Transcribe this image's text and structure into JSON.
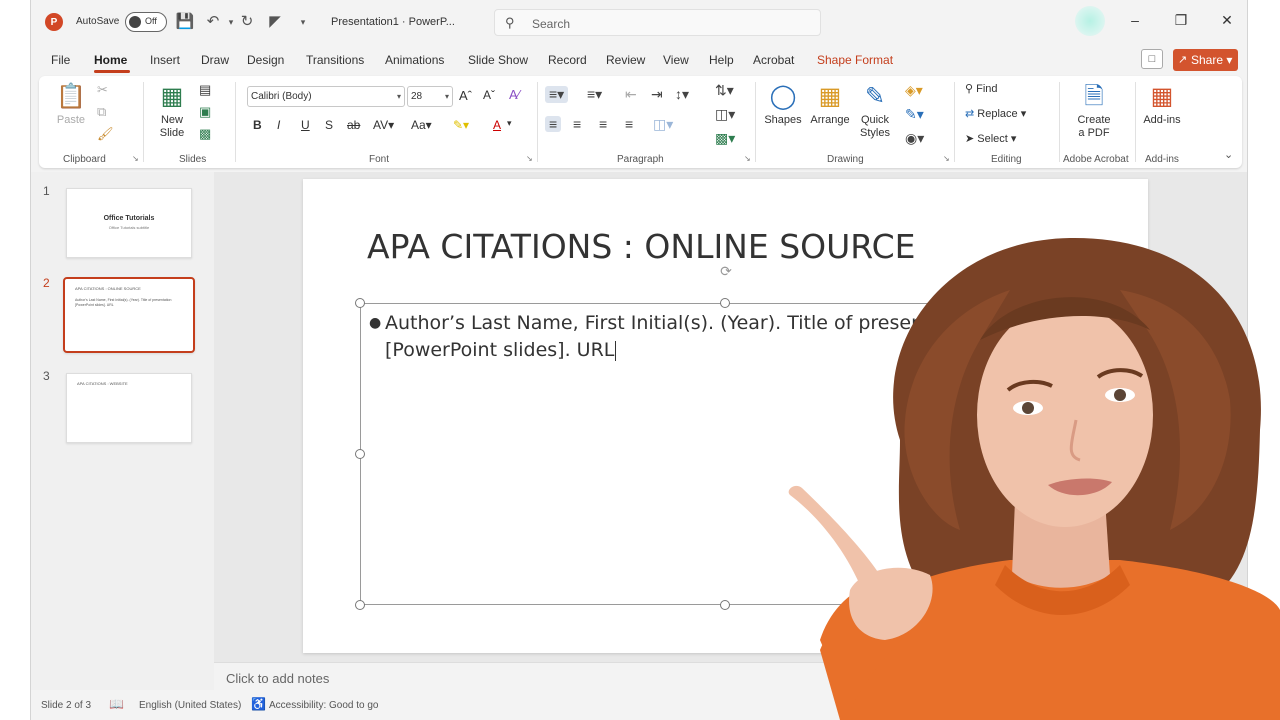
{
  "titlebar": {
    "autosave_label": "AutoSave",
    "autosave_state": "Off",
    "doc_title": "Presentation1  ·  PowerP...",
    "search_placeholder": "Search"
  },
  "tabs": [
    "File",
    "Home",
    "Insert",
    "Draw",
    "Design",
    "Transitions",
    "Animations",
    "Slide Show",
    "Record",
    "Review",
    "View",
    "Help",
    "Acrobat",
    "Shape Format"
  ],
  "share_label": "Share",
  "ribbon": {
    "clipboard": {
      "paste": "Paste",
      "label": "Clipboard"
    },
    "slides": {
      "new_slide": "New Slide",
      "label": "Slides"
    },
    "font": {
      "font_name": "Calibri (Body)",
      "font_size": "28",
      "label": "Font"
    },
    "paragraph": {
      "label": "Paragraph"
    },
    "drawing": {
      "shapes": "Shapes",
      "arrange": "Arrange",
      "quick_styles": "Quick Styles",
      "label": "Drawing"
    },
    "editing": {
      "find": "Find",
      "replace": "Replace",
      "select": "Select",
      "label": "Editing"
    },
    "acrobat": {
      "create_pdf": "Create a PDF",
      "label": "Adobe Acrobat"
    },
    "addins": {
      "addins": "Add-ins",
      "label": "Add-ins"
    }
  },
  "thumbnails": [
    {
      "num": "1",
      "title": "Office Tutorials",
      "subtitle": "Office Tutorials subtitle"
    },
    {
      "num": "2",
      "title": "APA CITATIONS : ONLINE SOURCE",
      "body": "Author's Last Name, First Initial(s). (Year). Title of presentation [PowerPoint slides]. URL"
    },
    {
      "num": "3",
      "title": "APA CITATIONS : WEBSITE"
    }
  ],
  "slide": {
    "title": "APA CITATIONS : ONLINE SOURCE",
    "body_line1": "Author’s Last Name, First Initial(s). (Year). Title of presen",
    "body_line2": "[PowerPoint slides]. URL"
  },
  "notes_placeholder": "Click to add notes",
  "status": {
    "slide_count": "Slide 2 of 3",
    "language": "English (United States)",
    "accessibility": "Accessibility: Good to go"
  },
  "colors": {
    "accent": "#c43e1c",
    "share": "#d3542e",
    "sweater": "#e8702a",
    "hair": "#7a4226"
  }
}
